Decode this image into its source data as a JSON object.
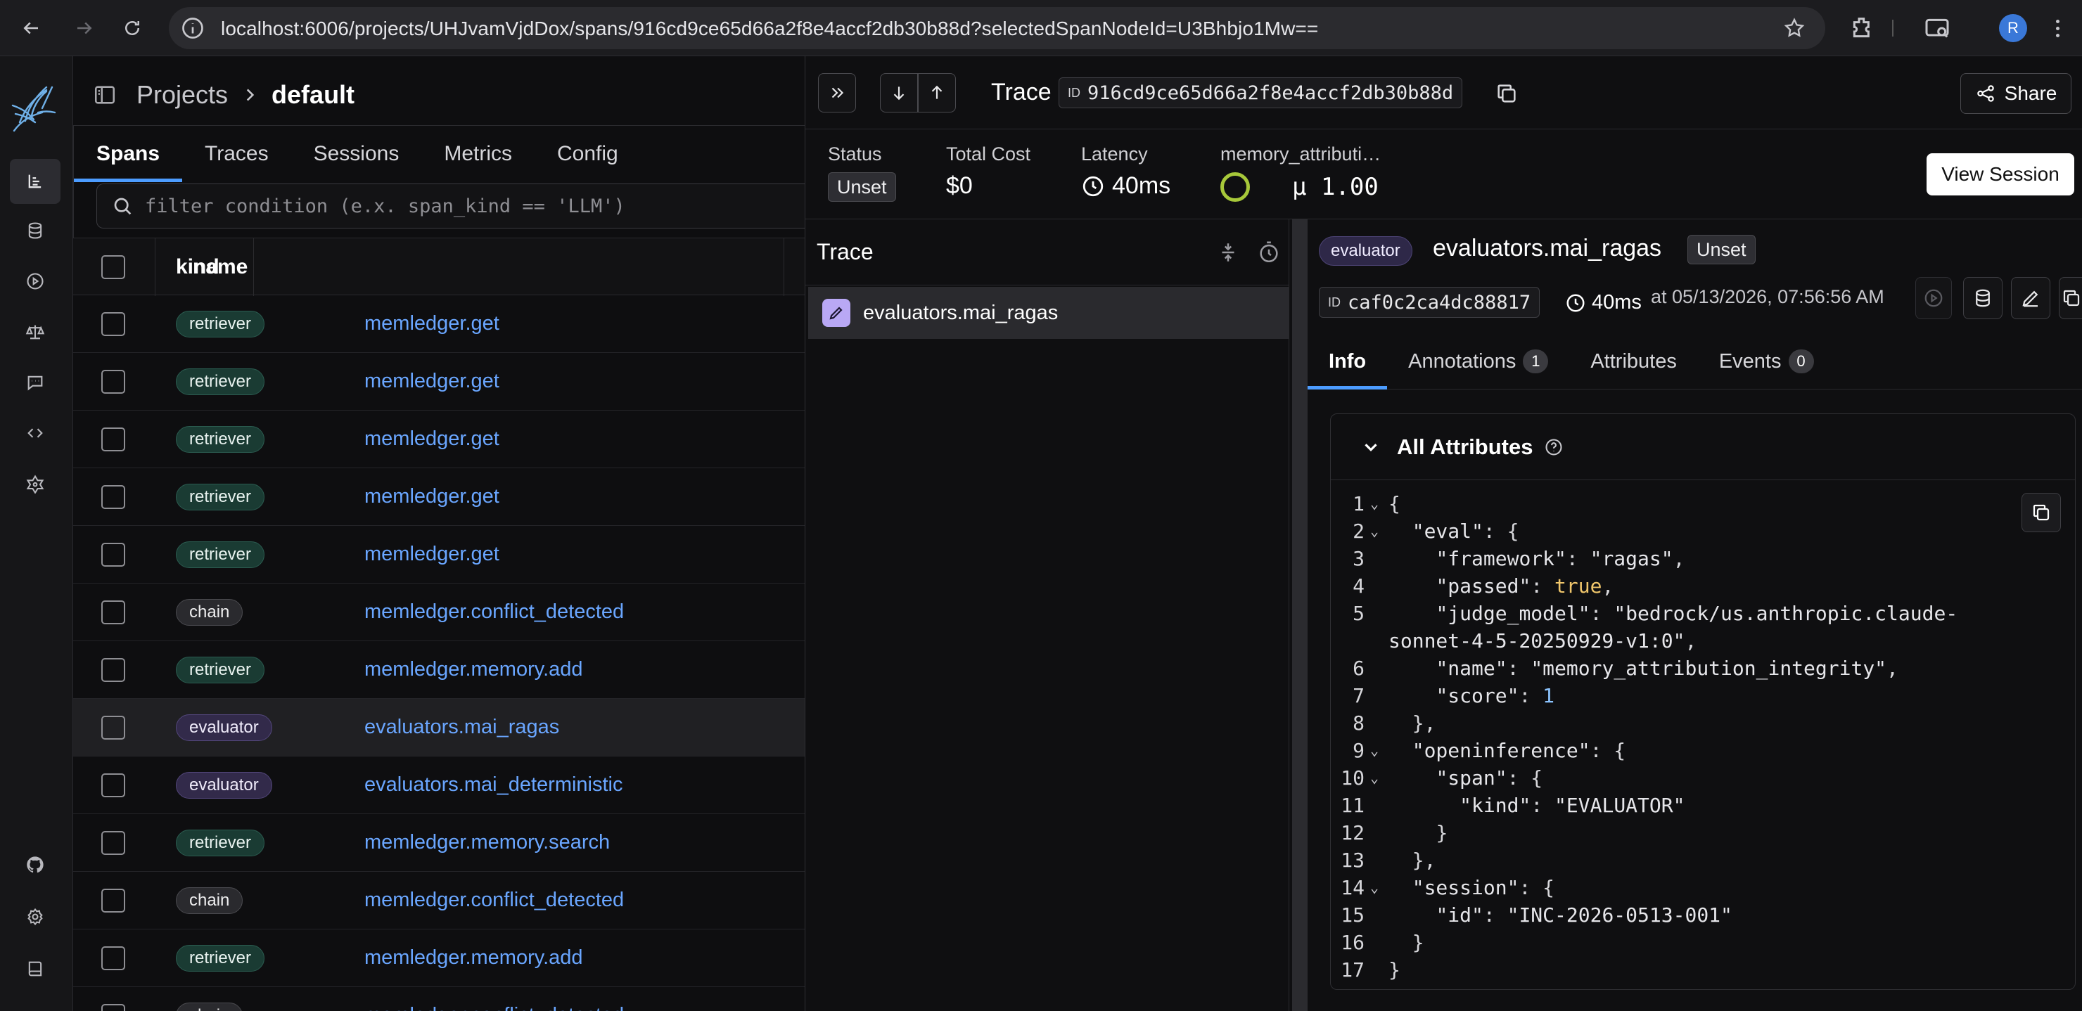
{
  "browser": {
    "url": "localhost:6006/projects/UHJvamVjdDox/spans/916cd9ce65d66a2f8e4accf2db30b88d?selectedSpanNodeId=U3Bhbjo1Mw==",
    "profile_initial": "R"
  },
  "breadcrumb": {
    "root": "Projects",
    "project": "default"
  },
  "tabs": [
    "Spans",
    "Traces",
    "Sessions",
    "Metrics",
    "Config"
  ],
  "filter": {
    "placeholder": "filter condition (e.x. span_kind == 'LLM')",
    "value": ""
  },
  "table": {
    "columns": {
      "kind": "kind",
      "name": "name"
    },
    "rows": [
      {
        "kind": "retriever",
        "name": "memledger.get"
      },
      {
        "kind": "retriever",
        "name": "memledger.get"
      },
      {
        "kind": "retriever",
        "name": "memledger.get"
      },
      {
        "kind": "retriever",
        "name": "memledger.get"
      },
      {
        "kind": "retriever",
        "name": "memledger.get"
      },
      {
        "kind": "chain",
        "name": "memledger.conflict_detected"
      },
      {
        "kind": "retriever",
        "name": "memledger.memory.add"
      },
      {
        "kind": "evaluator",
        "name": "evaluators.mai_ragas"
      },
      {
        "kind": "evaluator",
        "name": "evaluators.mai_deterministic"
      },
      {
        "kind": "retriever",
        "name": "memledger.memory.search"
      },
      {
        "kind": "chain",
        "name": "memledger.conflict_detected"
      },
      {
        "kind": "retriever",
        "name": "memledger.memory.add"
      },
      {
        "kind": "chain",
        "name": "memledger.conflict_detected"
      }
    ],
    "selected_index": 7
  },
  "trace": {
    "label": "Trace",
    "id_tag": "ID",
    "id": "916cd9ce65d66a2f8e4accf2db30b88d",
    "share_label": "Share",
    "stats": {
      "status_label": "Status",
      "status_value": "Unset",
      "cost_label": "Total Cost",
      "cost_value": "$0",
      "latency_label": "Latency",
      "latency_value": "40ms",
      "memory_label": "memory_attributi…",
      "memory_value": "µ 1.00"
    },
    "view_session_label": "View Session",
    "tree_title": "Trace",
    "tree_node": "evaluators.mai_ragas"
  },
  "span": {
    "kind": "evaluator",
    "name": "evaluators.mai_ragas",
    "status": "Unset",
    "id_tag": "ID",
    "id": "caf0c2ca4dc88817",
    "latency": "40ms",
    "timestamp": "at 05/13/2026, 07:56:56 AM",
    "tabs": [
      {
        "label": "Info",
        "count": ""
      },
      {
        "label": "Annotations",
        "count": "1"
      },
      {
        "label": "Attributes",
        "count": ""
      },
      {
        "label": "Events",
        "count": "0"
      }
    ],
    "attributes_title": "All Attributes"
  },
  "code_lines": [
    {
      "n": "1",
      "fold": true,
      "html": "{"
    },
    {
      "n": "2",
      "fold": true,
      "html": "  <span class='k'>\"eval\"</span>: {"
    },
    {
      "n": "3",
      "fold": false,
      "html": "    <span class='k'>\"framework\"</span>: <span class='s'>\"ragas\"</span>,"
    },
    {
      "n": "4",
      "fold": false,
      "html": "    <span class='k'>\"passed\"</span>: <span class='b'>true</span>,"
    },
    {
      "n": "5",
      "fold": false,
      "html": "    <span class='k'>\"judge_model\"</span>: <span class='s'>\"bedrock/us.anthropic.claude-sonnet-4-5-20250929-v1:0\"</span>,"
    },
    {
      "n": "6",
      "fold": false,
      "html": "    <span class='k'>\"name\"</span>: <span class='s'>\"memory_attribution_integrity\"</span>,"
    },
    {
      "n": "7",
      "fold": false,
      "html": "    <span class='k'>\"score\"</span>: <span class='n'>1</span>"
    },
    {
      "n": "8",
      "fold": false,
      "html": "  },"
    },
    {
      "n": "9",
      "fold": true,
      "html": "  <span class='k'>\"openinference\"</span>: {"
    },
    {
      "n": "10",
      "fold": true,
      "html": "    <span class='k'>\"span\"</span>: {"
    },
    {
      "n": "11",
      "fold": false,
      "html": "      <span class='k'>\"kind\"</span>: <span class='s'>\"EVALUATOR\"</span>"
    },
    {
      "n": "12",
      "fold": false,
      "html": "    }"
    },
    {
      "n": "13",
      "fold": false,
      "html": "  },"
    },
    {
      "n": "14",
      "fold": true,
      "html": "  <span class='k'>\"session\"</span>: {"
    },
    {
      "n": "15",
      "fold": false,
      "html": "    <span class='k'>\"id\"</span>: <span class='s'>\"INC-2026-0513-001\"</span>"
    },
    {
      "n": "16",
      "fold": false,
      "html": "  }"
    },
    {
      "n": "17",
      "fold": false,
      "html": "}"
    }
  ],
  "colors": {
    "accent": "#4c9cff",
    "link": "#6aa6ff",
    "score_ring": "#a7c83a",
    "evaluator_icon": "#b9a8f5"
  }
}
